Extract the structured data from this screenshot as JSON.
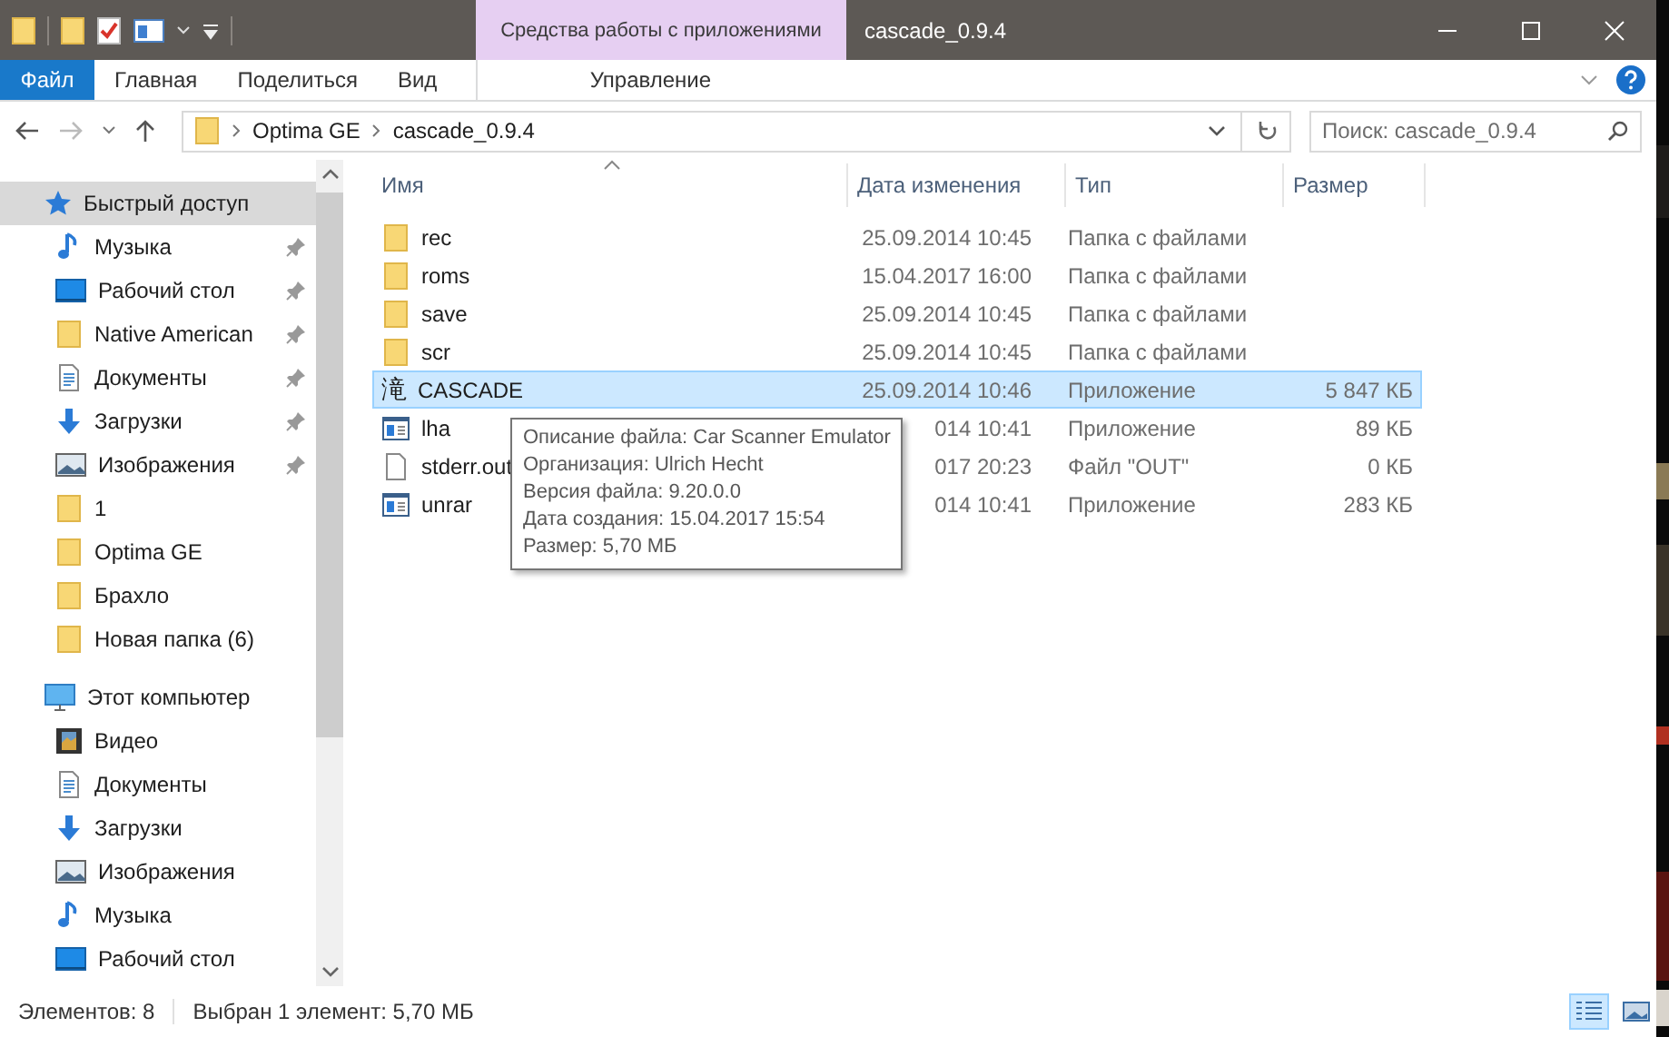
{
  "window": {
    "title": "cascade_0.9.4",
    "context_tab": "Средства работы с приложениями"
  },
  "ribbon_tabs": [
    {
      "label": "Файл",
      "kind": "file"
    },
    {
      "label": "Главная",
      "kind": "tab"
    },
    {
      "label": "Поделиться",
      "kind": "tab"
    },
    {
      "label": "Вид",
      "kind": "tab"
    },
    {
      "label": "Управление",
      "kind": "context"
    }
  ],
  "address": {
    "path": [
      "Optima GE",
      "cascade_0.9.4"
    ]
  },
  "search": {
    "placeholder": "Поиск: cascade_0.9.4"
  },
  "sidebar": {
    "items": [
      {
        "label": "Быстрый доступ",
        "kind": "star",
        "selected": true,
        "children": [
          {
            "label": "Музыка",
            "kind": "music",
            "pinned": true,
            "selected": false
          },
          {
            "label": "Рабочий стол",
            "kind": "desktop",
            "pinned": true,
            "selected": false
          },
          {
            "label": "Native American",
            "kind": "folder",
            "pinned": true,
            "selected": false
          },
          {
            "label": "Документы",
            "kind": "documents",
            "pinned": true,
            "selected": false
          },
          {
            "label": "Загрузки",
            "kind": "downloads",
            "pinned": true,
            "selected": false
          },
          {
            "label": "Изображения",
            "kind": "images",
            "pinned": true,
            "selected": false
          },
          {
            "label": "1",
            "kind": "folder",
            "pinned": false,
            "selected": false
          },
          {
            "label": "Optima GE",
            "kind": "folder",
            "pinned": false,
            "selected": false
          },
          {
            "label": "Брахло",
            "kind": "folder",
            "pinned": false,
            "selected": false
          },
          {
            "label": "Новая папка (6)",
            "kind": "folder",
            "pinned": false,
            "selected": false
          }
        ]
      },
      {
        "label": "Этот компьютер",
        "kind": "pc",
        "selected": false,
        "children": [
          {
            "label": "Видео",
            "kind": "video",
            "pinned": false,
            "selected": false
          },
          {
            "label": "Документы",
            "kind": "documents",
            "pinned": false,
            "selected": false
          },
          {
            "label": "Загрузки",
            "kind": "downloads",
            "pinned": false,
            "selected": false
          },
          {
            "label": "Изображения",
            "kind": "images",
            "pinned": false,
            "selected": false
          },
          {
            "label": "Музыка",
            "kind": "music",
            "pinned": false,
            "selected": false
          },
          {
            "label": "Рабочий стол",
            "kind": "desktop",
            "pinned": false,
            "selected": false
          }
        ]
      }
    ]
  },
  "table": {
    "columns": [
      "Имя",
      "Дата изменения",
      "Тип",
      "Размер"
    ],
    "rows": [
      {
        "name": "rec",
        "kind": "folder",
        "date": "25.09.2014 10:45",
        "type": "Папка с файлами",
        "selected": false
      },
      {
        "name": "roms",
        "kind": "folder",
        "date": "15.04.2017 16:00",
        "type": "Папка с файлами",
        "selected": false
      },
      {
        "name": "save",
        "kind": "folder",
        "date": "25.09.2014 10:45",
        "type": "Папка с файлами",
        "selected": false
      },
      {
        "name": "scr",
        "kind": "folder",
        "date": "25.09.2014 10:45",
        "type": "Папка с файлами",
        "selected": false
      },
      {
        "name": "CASCADE",
        "kind": "glyph",
        "icon_text": "滝",
        "date": "25.09.2014 10:46",
        "type": "Приложение",
        "size": "5 847 КБ",
        "selected": true
      },
      {
        "name": "lha",
        "kind": "app",
        "date": "014 10:41",
        "type": "Приложение",
        "size": "89 КБ",
        "selected": false
      },
      {
        "name": "stderr.out",
        "kind": "file",
        "date": "017 20:23",
        "type": "Файл \"OUT\"",
        "size": "0 КБ",
        "selected": false
      },
      {
        "name": "unrar",
        "kind": "app",
        "date": "014 10:41",
        "type": "Приложение",
        "size": "283 КБ",
        "selected": false
      }
    ]
  },
  "tooltip": {
    "lines": [
      "Описание файла: Car Scanner Emulator",
      "Организация: Ulrich Hecht",
      "Версия файла: 9.20.0.0",
      "Дата создания: 15.04.2017 15:54",
      "Размер: 5,70 МБ"
    ]
  },
  "status_bar": {
    "count": "Элементов: 8",
    "selection": "Выбран 1 элемент: 5,70 МБ"
  },
  "view_buttons": [
    {
      "kind": "details",
      "selected": true
    },
    {
      "kind": "tiles",
      "selected": false
    }
  ]
}
